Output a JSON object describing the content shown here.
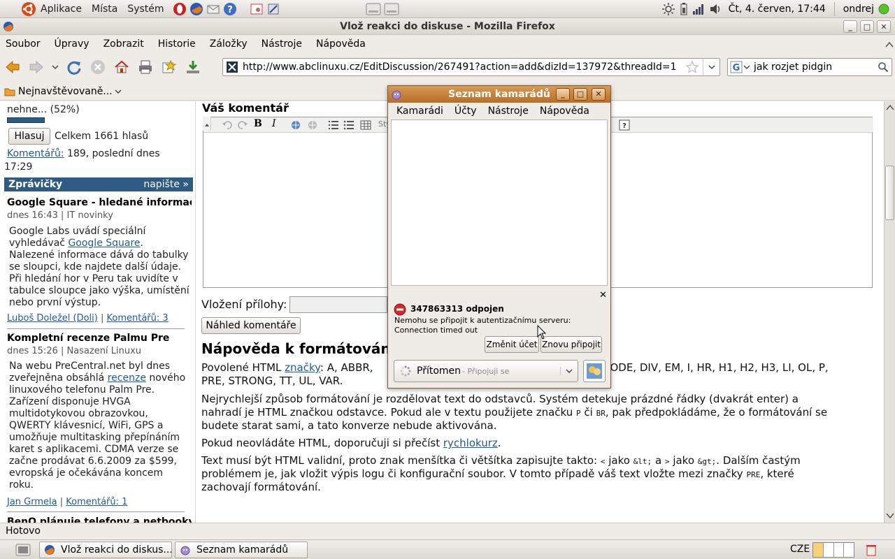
{
  "top_panel": {
    "menus": [
      "Aplikace",
      "Místa",
      "Systém"
    ],
    "clock": "Čt,  4. červen, 17:44",
    "user": "ondrej"
  },
  "window": {
    "title": "Vlož reakci do diskuse - Mozilla Firefox"
  },
  "menubar": [
    "Soubor",
    "Úpravy",
    "Zobrazit",
    "Historie",
    "Záložky",
    "Nástroje",
    "Nápověda"
  ],
  "navbar": {
    "url": "http://www.abclinuxu.cz/EditDiscussion/267491?action=add&dizId=137972&threadId=1",
    "search": "jak rozjet pidgin"
  },
  "bookmarks": {
    "label": "Nejnavštěvovaně..."
  },
  "sidebar": {
    "poll_tail": "nehne... (52%)",
    "poll_bar": 0.52,
    "vote_button": "Hlasuj",
    "total_votes": "Celkem 1661 hlasů",
    "comments_link": "Komentářů:",
    "comments_rest": " 189, poslední dnes",
    "comments_time": "17:29",
    "news_header": "Zprávičky",
    "news_write": "napište »",
    "news": [
      {
        "title": "Google Square - hledané informace",
        "meta": "dnes 16:43 | IT novinky",
        "body_pre": "Google Labs uvádí speciální vyhledávač ",
        "body_link": "Google Square",
        "body_post": ". Nalezené informace dává do tabulky se sloupci, kde najdete další údaje. Při hledání hor v Peru tak uvidíte v tabulce sloupce jako výška, umístění nebo první výstup.",
        "author": "Luboš Doležel (Doli)",
        "comments": "Komentářů: 3"
      },
      {
        "title": "Kompletní recenze Palmu Pre",
        "meta": "dnes 15:26 | Nasazení Linuxu",
        "body_pre": "Na webu PreCentral.net byl dnes zveřejněna obsáhlá ",
        "body_link": "recenze",
        "body_post": " nového linuxového telefonu Palm Pre. Zařízení disponuje HVGA multidotykovou obrazovkou, QWERTY klávesnicí, WiFi, GPS a umožňuje multitasking přepínáním karet s aplikacemi. CDMA verze se začne prodávat 6.6.2009 za $599, evropská je očekávána koncem roku.",
        "author": "Jan Grmela",
        "comments": "Komentářů: 1"
      }
    ],
    "next_news": "BenQ plánuje telefony a netbooky"
  },
  "main": {
    "comment_heading": "Váš komentář",
    "toolbar_style": "Sty",
    "attach_label": "Vložení přílohy:",
    "preview_button": "Náhled komentáře",
    "help_heading": "Nápověda k formátování",
    "p1_pre": "Povolené HTML ",
    "p1_link": "značky",
    "p1_left": ": A, ABBR,",
    "p1_right": "CODE, DIV, EM, I, HR, H1, H2, H3, LI, OL, P,",
    "p1_line2": "PRE, STRONG, TT, UL, VAR.",
    "p2_l1": "Nejrychlejší způsob formátování je rozdělovat text do odstavců. Systém detekuje prázdné řádky (dvakrát enter) a",
    "p2_l2_a": "nahradí je HTML značkou odstavce. Pokud ale v textu použijete značku ",
    "p2_l2_b": "P",
    "p2_l2_c": " či ",
    "p2_l2_d": "BR",
    "p2_l2_e": ", pak předpokládáme, že o formátování se",
    "p2_l3": "budete starat sami, a tato konverze nebude aktivována.",
    "p3_pre": "Pokud neovládáte HTML, doporučuji si přečíst ",
    "p3_link": "rychlokurz",
    "p3_post": ".",
    "p4_l1_a": "Text musí být HTML validní, proto znak menšítka či většítka zapisujte takto: ",
    "p4_l1_b": "<",
    "p4_l1_c": " jako ",
    "p4_l1_d": "&lt;",
    "p4_l1_e": " a ",
    "p4_l1_f": ">",
    "p4_l1_g": " jako ",
    "p4_l1_h": "&gt;",
    "p4_l1_i": ". Dalším častým",
    "p4_l2_a": "problémem je, jak vložit výpis logu či konfigurační soubor. V tomto případě váš text vložte mezi značky ",
    "p4_l2_b": "PRE",
    "p4_l2_c": ", které",
    "p4_l3": "zachovají formátování."
  },
  "statusbar": {
    "text": "Hotovo"
  },
  "taskbar": {
    "tasks": [
      "Vlož reakci do diskus...",
      "Seznam kamarádů"
    ],
    "keyboard": "CZE"
  },
  "pidgin": {
    "title": "Seznam kamarádů",
    "menus": [
      "Kamarádi",
      "Účty",
      "Nástroje",
      "Nápověda"
    ],
    "account": "347863313 odpojen",
    "error_l1": "Nemohu se připojit k autentizačnímu serveru:",
    "error_l2": "Connection timed out",
    "btn_change": "Změnit účet",
    "btn_reconnect": "Znovu připojit",
    "status": "Přítomen",
    "status_sub": " - Připojuji se"
  }
}
